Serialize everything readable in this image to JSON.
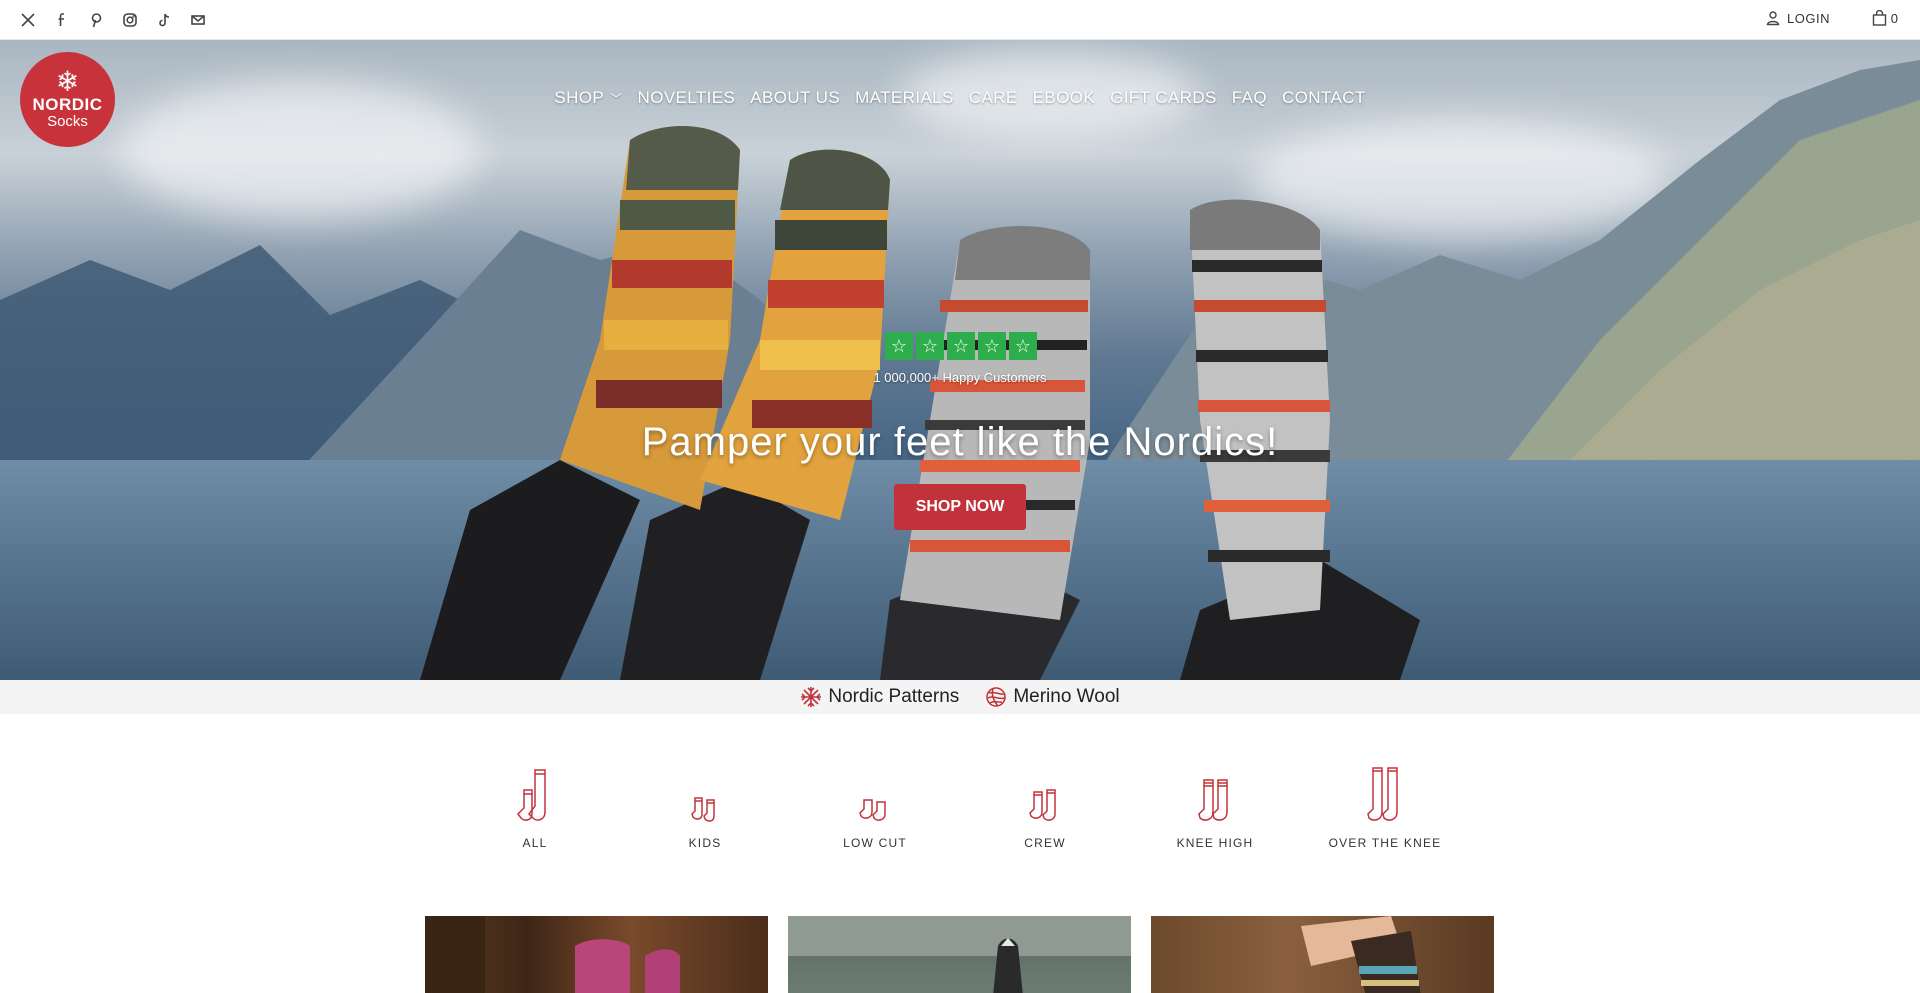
{
  "topbar": {
    "socials": [
      {
        "icon": "x-twitter-icon"
      },
      {
        "icon": "facebook-icon"
      },
      {
        "icon": "pinterest-icon"
      },
      {
        "icon": "instagram-icon"
      },
      {
        "icon": "tiktok-icon"
      },
      {
        "icon": "email-icon"
      }
    ],
    "login_label": "LOGIN",
    "cart_count": "0"
  },
  "brand": {
    "line1": "NORDIC",
    "line2": "Socks",
    "color": "#c8323a"
  },
  "nav": {
    "items": [
      {
        "label": "SHOP",
        "has_dropdown": true
      },
      {
        "label": "NOVELTIES"
      },
      {
        "label": "ABOUT US"
      },
      {
        "label": "MATERIALS"
      },
      {
        "label": "CARE"
      },
      {
        "label": "EBOOK"
      },
      {
        "label": "GIFT CARDS"
      },
      {
        "label": "FAQ"
      },
      {
        "label": "CONTACT"
      }
    ]
  },
  "hero": {
    "rating_stars": 5,
    "star_color": "#2dad4c",
    "customers_text": "1 000,000+ Happy Customers",
    "headline": "Pamper your feet like the Nordics!",
    "cta_label": "SHOP NOW",
    "cta_color": "#c1323a"
  },
  "usp": {
    "items": [
      {
        "label": "Nordic Patterns",
        "icon": "snowflake-icon"
      },
      {
        "label": "Merino Wool",
        "icon": "yarn-ball-icon"
      }
    ]
  },
  "categories": [
    {
      "label": "ALL",
      "icon": "socks-all-icon"
    },
    {
      "label": "KIDS",
      "icon": "socks-kids-icon"
    },
    {
      "label": "LOW CUT",
      "icon": "socks-low-cut-icon"
    },
    {
      "label": "CREW",
      "icon": "socks-crew-icon"
    },
    {
      "label": "KNEE HIGH",
      "icon": "socks-knee-high-icon"
    },
    {
      "label": "OVER THE KNEE",
      "icon": "socks-over-knee-icon"
    }
  ],
  "accent_color": "#c1323a"
}
